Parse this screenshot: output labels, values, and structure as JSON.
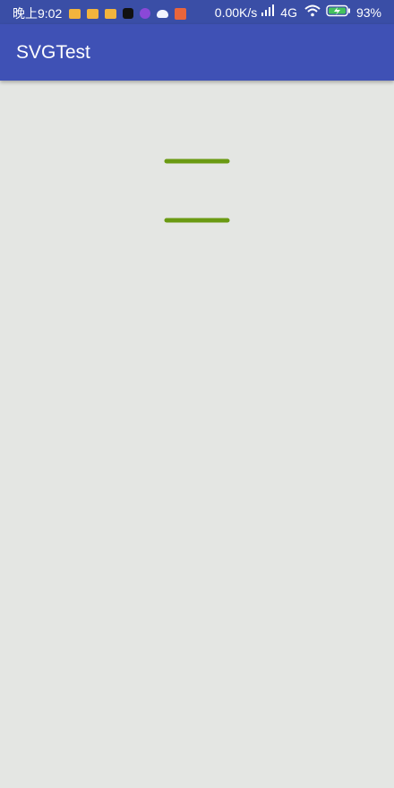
{
  "status_bar": {
    "time": "晚上9:02",
    "network_speed": "0.00K/s",
    "network_type": "4G",
    "battery": "93%",
    "icons": [
      "weibo-icon",
      "weibo-icon",
      "weibo-icon",
      "tiktok-icon",
      "purple-app-icon",
      "bird-app-icon",
      "orange-app-icon",
      "signal-icon",
      "wifi-icon",
      "battery-icon"
    ]
  },
  "app_bar": {
    "title": "SVGTest",
    "color": "#3f51b5"
  },
  "content": {
    "background": "#e4e6e3",
    "line_color": "#6a9a12"
  }
}
